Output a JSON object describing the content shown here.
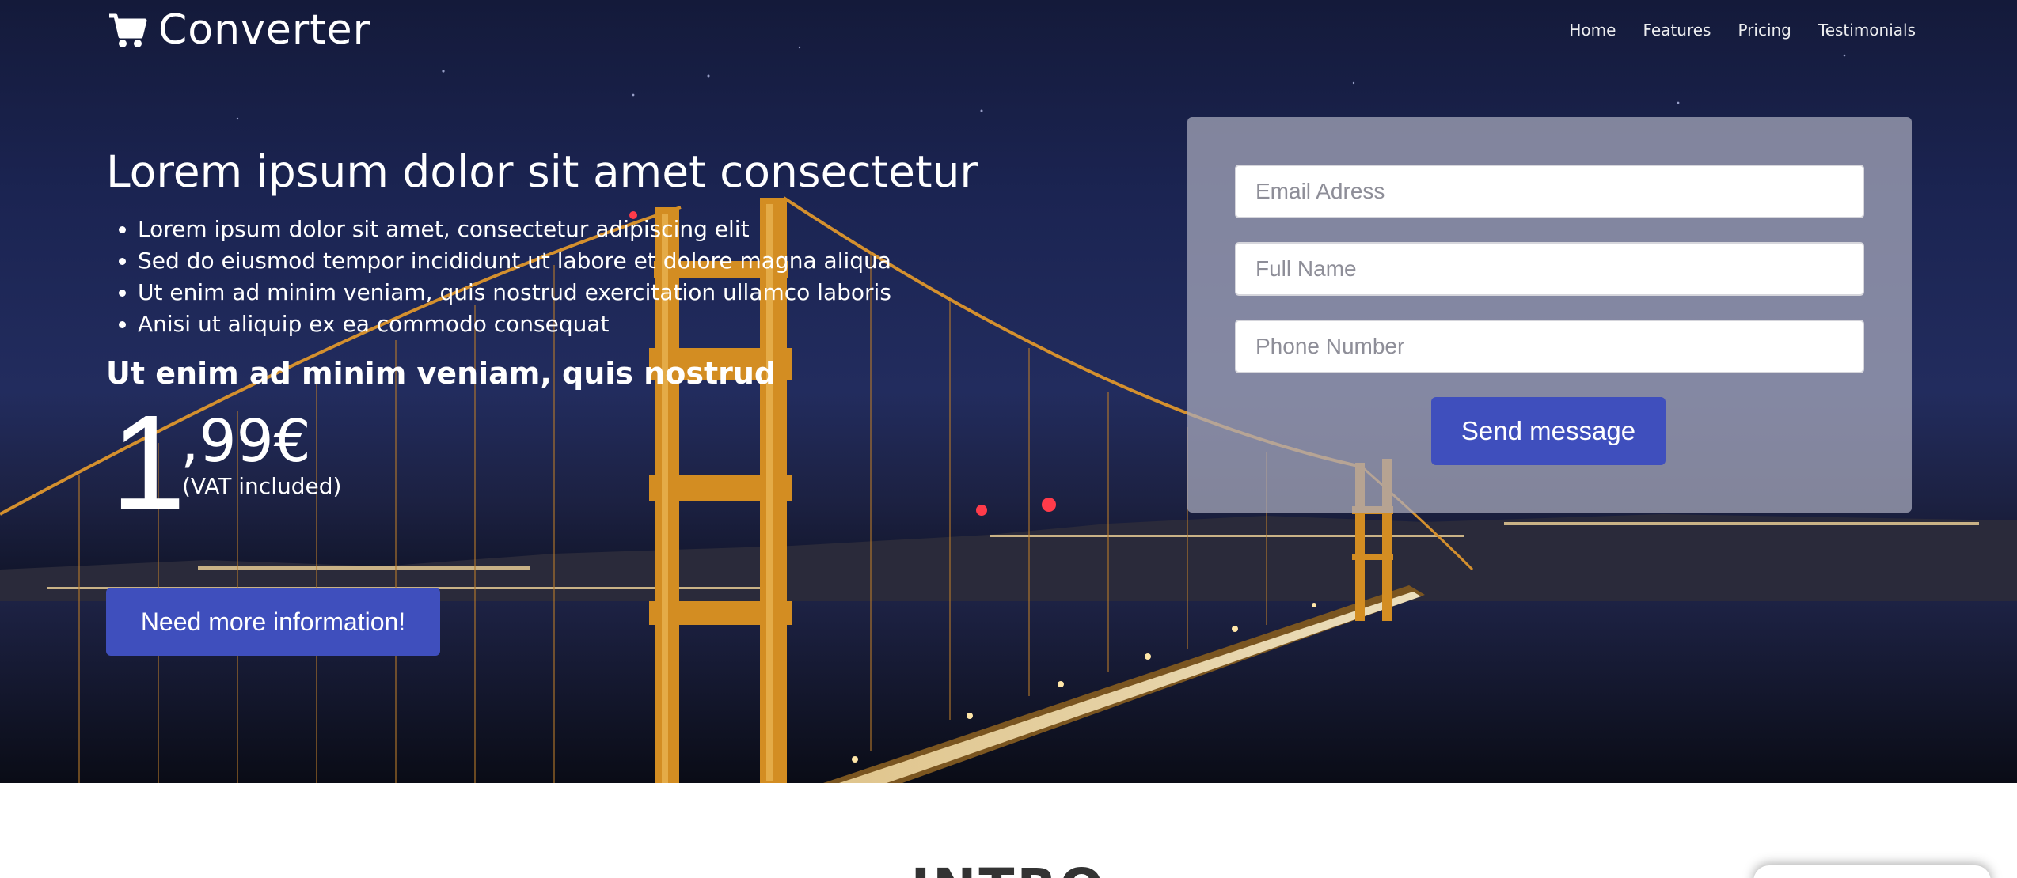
{
  "nav": {
    "brand": "Converter",
    "links": [
      "Home",
      "Features",
      "Pricing",
      "Testimonials"
    ]
  },
  "hero": {
    "headline": "Lorem ipsum dolor sit amet consectetur",
    "bullets": [
      "Lorem ipsum dolor sit amet, consectetur adipiscing elit",
      "Sed do eiusmod tempor incididunt ut labore et dolore magna aliqua",
      "Ut enim ad minim veniam, quis nostrud exercitation ullamco laboris",
      "Anisi ut aliquip ex ea commodo consequat"
    ],
    "subheadline": "Ut enim ad minim veniam, quis nostrud",
    "price": {
      "integer": "1",
      "decimal": ",99€",
      "note": "(VAT included)"
    },
    "cta_label": "Need more information!"
  },
  "form": {
    "email_placeholder": "Email Adress",
    "name_placeholder": "Full Name",
    "phone_placeholder": "Phone Number",
    "submit_label": "Send message"
  },
  "intro": {
    "title": "INTRO"
  },
  "colors": {
    "accent": "#3f4fbd",
    "panel": "#aaacbe"
  }
}
